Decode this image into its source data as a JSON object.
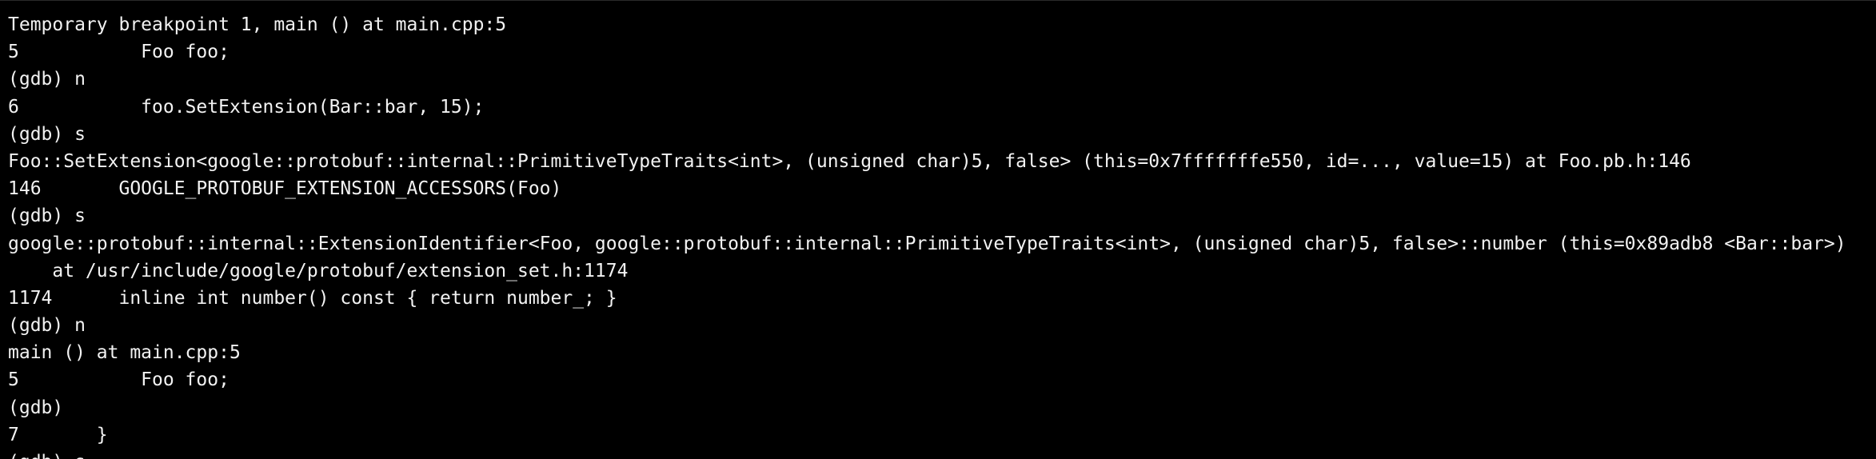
{
  "terminal": {
    "lines": [
      "Temporary breakpoint 1, main () at main.cpp:5",
      "5           Foo foo;",
      "(gdb) n",
      "6           foo.SetExtension(Bar::bar, 15);",
      "(gdb) s",
      "Foo::SetExtension<google::protobuf::internal::PrimitiveTypeTraits<int>, (unsigned char)5, false> (this=0x7fffffffe550, id=..., value=15) at Foo.pb.h:146",
      "146       GOOGLE_PROTOBUF_EXTENSION_ACCESSORS(Foo)",
      "(gdb) s",
      "google::protobuf::internal::ExtensionIdentifier<Foo, google::protobuf::internal::PrimitiveTypeTraits<int>, (unsigned char)5, false>::number (this=0x89adb8 <Bar::bar>)",
      "    at /usr/include/google/protobuf/extension_set.h:1174",
      "1174      inline int number() const { return number_; }",
      "(gdb) n",
      "main () at main.cpp:5",
      "5           Foo foo;",
      "(gdb)",
      "7       }",
      "(gdb) s"
    ]
  }
}
